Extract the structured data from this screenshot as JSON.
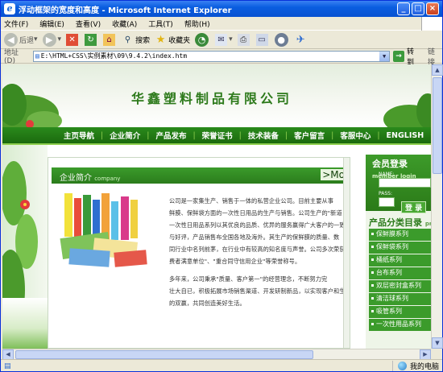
{
  "window": {
    "title": "浮动框架的宽度和高度 - Microsoft Internet Explorer"
  },
  "menu": [
    "文件(F)",
    "编辑(E)",
    "查看(V)",
    "收藏(A)",
    "工具(T)",
    "帮助(H)"
  ],
  "toolbar": {
    "back": "后退",
    "search": "搜索",
    "favorites": "收藏夹"
  },
  "address": {
    "label": "地址(D)",
    "value": "E:\\HTML+CSS\\实例素材\\09\\9.4.2\\index.htm",
    "go": "转到",
    "links": "链接"
  },
  "status": {
    "text": "",
    "zone": "我的电脑"
  },
  "site": {
    "title": "华鑫塑料制品有限公司",
    "nav": [
      "主页导航",
      "企业简介",
      "产品发布",
      "荣誉证书",
      "技术装备",
      "客户留言",
      "客服中心",
      "ENGLISH"
    ],
    "section": {
      "title": "企业简介",
      "subtitle": "company",
      "more": ">Mo"
    },
    "intro": [
      "公司是一家集生产、销售于一体的私营企业公司。目前主要从事",
      "鲜膜、保鲜袋方面的一次性日用品的生产与销售。公司生产的\"新道",
      "一次性日用品系列以其优良的品质、优异的服务赢得广大客户的一致",
      "与好评，产品销售布全国各地及海外。其生产的保鲜膜的质量、数",
      "同行业中名列前茅，在行业中有较高的知名度与声誉。公司多次荣获",
      "费者满意单位\"、\"重合同守信用企业\"等荣誉称号。"
    ],
    "intro2": [
      "多年来，公司秉承\"质量、客户第一\"的经营理念，不断努力完",
      "壮大自已，积极拓展市场销售渠道、开发研制新品，以实现客户和生",
      "的双赢，共同创造美好生活。"
    ],
    "login": {
      "title": "会员登录",
      "subtitle": "member login",
      "name": "NAME:",
      "pass": "PASS:",
      "button": "登 录"
    },
    "categories": {
      "title": "产品分类目录",
      "subtitle": "products",
      "items": [
        "保鲜膜系列",
        "保鲜袋系列",
        "桶纸系列",
        "台布系列",
        "双层密封盒系列",
        "清洁球系列",
        "吸管系列",
        "一次性用品系列"
      ]
    }
  }
}
